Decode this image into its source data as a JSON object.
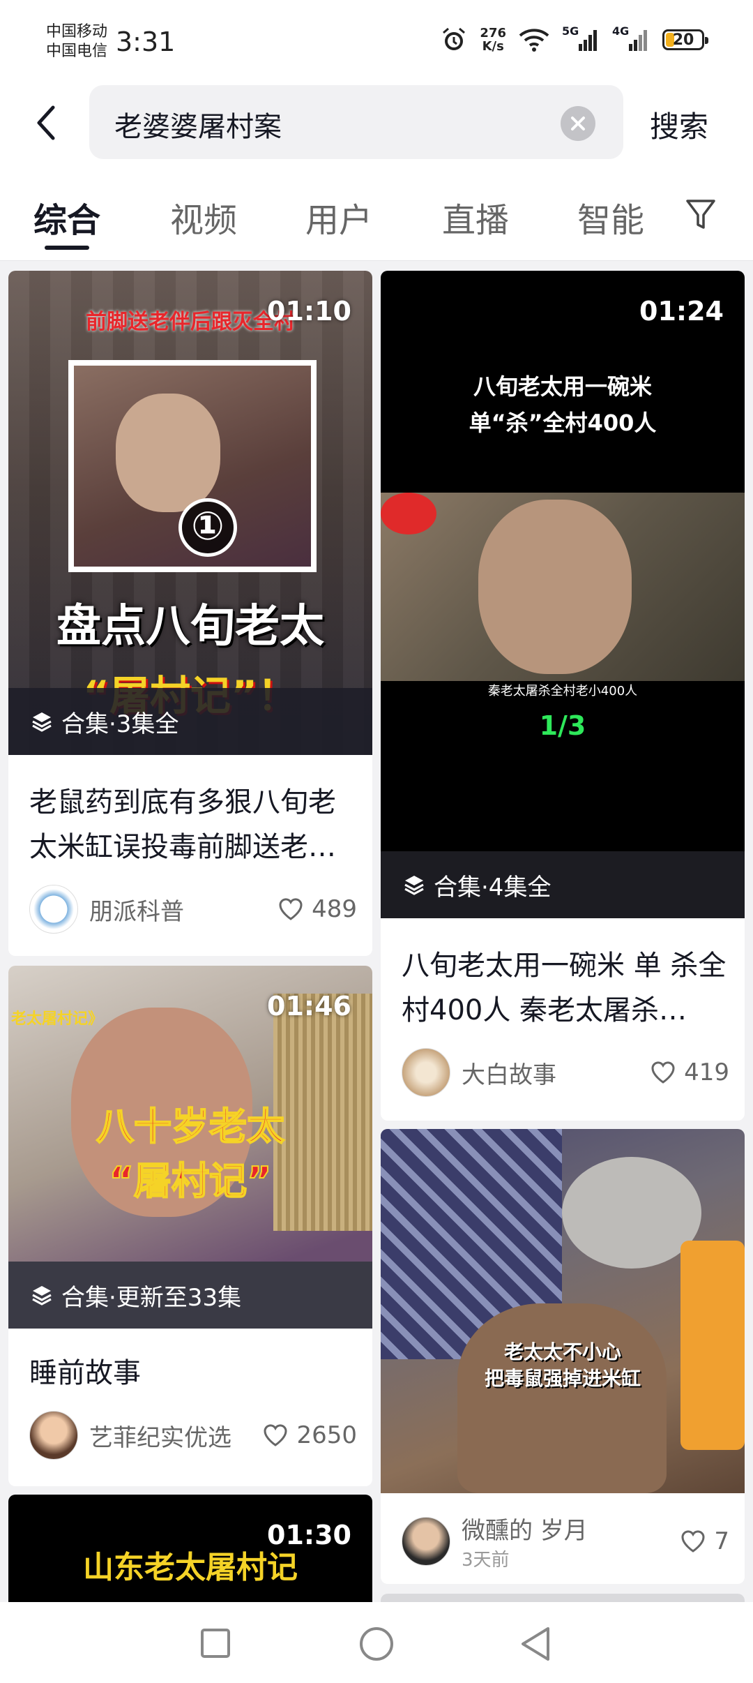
{
  "status": {
    "carrier1": "中国移动",
    "carrier2": "中国电信",
    "time": "3:31",
    "speed_value": "276",
    "speed_unit": "K/s",
    "net1": "5G",
    "net2": "4G",
    "battery": "20"
  },
  "search": {
    "query": "老婆婆屠村案",
    "button": "搜索"
  },
  "tabs": [
    "综合",
    "视频",
    "用户",
    "直播",
    "智能"
  ],
  "cards": [
    {
      "duration": "01:10",
      "overlay_top": "前脚送老伴后跟灭全村",
      "overlay_big": "盘点八旬老太",
      "overlay_sub": "“屠村记”！",
      "circle_num": "①",
      "collection": "合集·3集全",
      "title": "老鼠药到底有多狠八旬老太米缸误投毒前脚送老…",
      "author": "朋派科普",
      "likes": "489"
    },
    {
      "duration": "01:24",
      "overlay_l1": "八旬老太用一碗米",
      "overlay_l2": "单“杀”全村400人",
      "caption": "秦老太屠杀全村老小400人",
      "counter": "1/3",
      "collection": "合集·4集全",
      "title": "八旬老太用一碗米 单 杀全村400人 秦老太屠杀…",
      "author": "大白故事",
      "likes": "419"
    },
    {
      "duration": "01:46",
      "overlay_tag": "老太屠村记》",
      "overlay_l1": "八十岁老太",
      "overlay_l2": "“屠村记”",
      "collection": "合集·更新至33集",
      "title": "睡前故事",
      "author": "艺菲纪实优选",
      "likes": "2650"
    },
    {
      "overlay_l1": "老太太不小心",
      "overlay_l2": "把毒鼠强掉进米缸",
      "author": "微醺的 岁月",
      "time_ago": "3天前",
      "likes": "7"
    },
    {
      "duration": "01:30",
      "overlay_l1": "山东老太屠村记"
    }
  ],
  "colors": {
    "accent": "#161823",
    "overlay_red": "#e8262b",
    "overlay_yellow": "#f5d327",
    "counter_green": "#2ee85a"
  }
}
